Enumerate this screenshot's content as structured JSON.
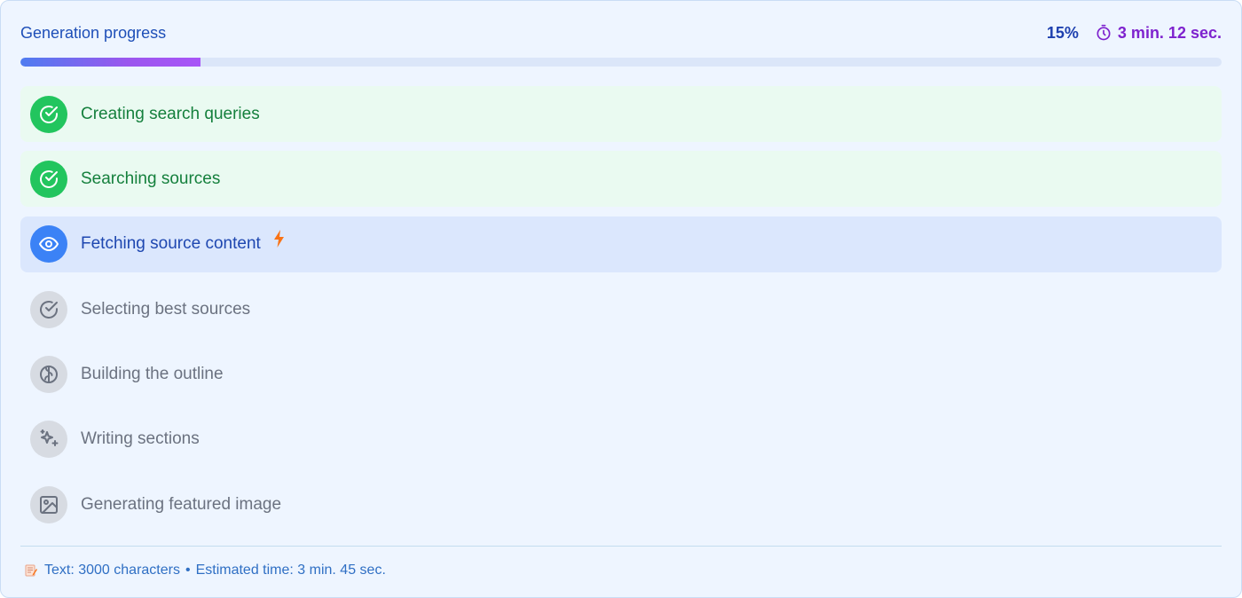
{
  "header": {
    "title": "Generation progress",
    "percent_label": "15%",
    "progress_fraction": 0.15,
    "timer_icon": "stopwatch-icon",
    "timer_label": "3 min. 12 sec."
  },
  "steps": [
    {
      "label": "Creating search queries",
      "status": "done",
      "icon": "check-circle-icon"
    },
    {
      "label": "Searching sources",
      "status": "done",
      "icon": "check-circle-icon"
    },
    {
      "label": "Fetching source content",
      "status": "active",
      "icon": "eye-icon",
      "badge_icon": "lightning-icon"
    },
    {
      "label": "Selecting best sources",
      "status": "pending",
      "icon": "check-circle-icon"
    },
    {
      "label": "Building the outline",
      "status": "pending",
      "icon": "brain-icon"
    },
    {
      "label": "Writing sections",
      "status": "pending",
      "icon": "sparkles-icon"
    },
    {
      "label": "Generating featured image",
      "status": "pending",
      "icon": "image-icon"
    }
  ],
  "footer": {
    "icon": "memo-icon",
    "text": "Text: 3000 characters",
    "separator": "•",
    "estimate": "Estimated time: 3 min. 45 sec."
  },
  "colors": {
    "done": "#22c55e",
    "active": "#3b82f6",
    "pending": "#d7dbe2",
    "accent_purple": "#7e22ce"
  }
}
